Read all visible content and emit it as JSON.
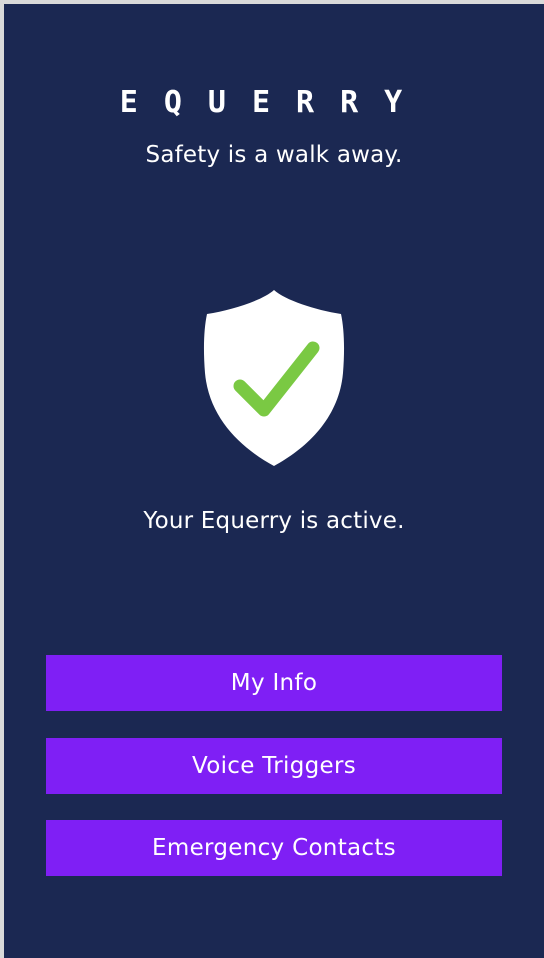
{
  "app": {
    "logo_text": "EQUERRY",
    "tagline": "Safety is a walk away.",
    "status_text": "Your Equerry is active."
  },
  "icons": {
    "shield": "shield-check-icon"
  },
  "colors": {
    "background": "#1b2852",
    "button": "#7f1ff5",
    "check": "#7ac943",
    "shield": "#ffffff"
  },
  "buttons": {
    "my_info": "My Info",
    "voice_triggers": "Voice Triggers",
    "emergency_contacts": "Emergency Contacts"
  }
}
